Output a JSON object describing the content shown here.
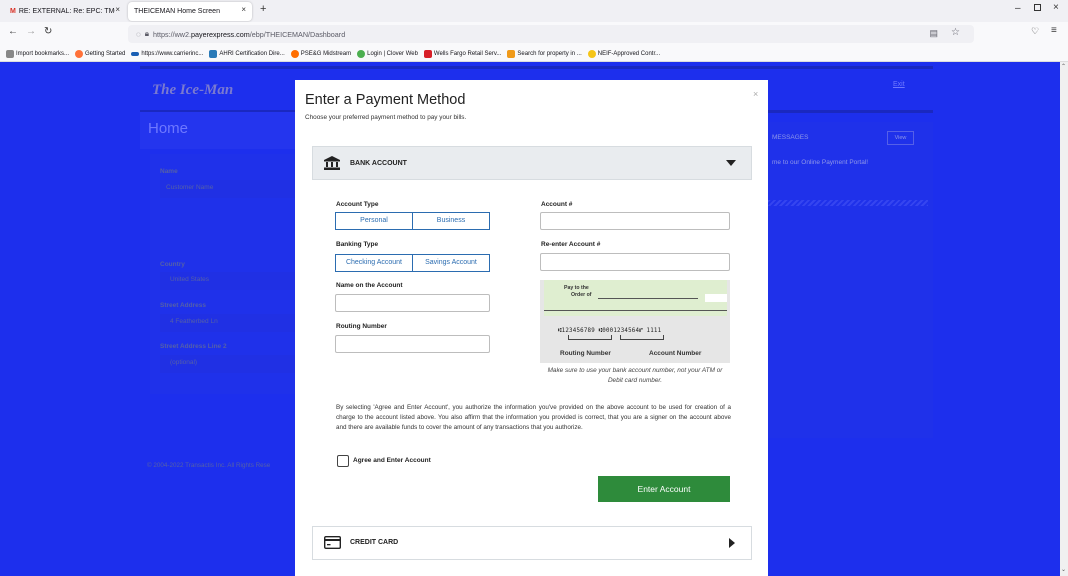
{
  "browser": {
    "tabs": [
      {
        "label": "RE: EXTERNAL: Re: EPC: TMCC",
        "icon": "gmail-icon"
      },
      {
        "label": "THEICEMAN Home Screen",
        "icon": ""
      }
    ],
    "new_tab": "+",
    "url_prefix": "https://ww2.",
    "url_host": "payerexpress.com",
    "url_path": "/ebp/THEICEMAN/Dashboard",
    "bookmarks": [
      {
        "label": "Import bookmarks...",
        "color": "#666666"
      },
      {
        "label": "Getting Started",
        "color": "#ff7139"
      },
      {
        "label": "https://www.carrierinc...",
        "color": "#1a5fb4"
      },
      {
        "label": "AHRI Certification Dire...",
        "color": "#2a7ab8"
      },
      {
        "label": "PSE&G Midstream",
        "color": "#ff6d00"
      },
      {
        "label": "Login | Clover Web",
        "color": "#4caf50"
      },
      {
        "label": "Wells Fargo Retail Serv...",
        "color": "#d71e28"
      },
      {
        "label": "Search for property in ...",
        "color": "#f09a1a"
      },
      {
        "label": "NEIF-Approved Contr...",
        "color": "#f5c518"
      }
    ]
  },
  "background": {
    "logo": "The Ice-Man",
    "exit": "Exit",
    "home_title": "Home",
    "fields": {
      "name_label": "Name",
      "name_value": "Customer Name",
      "country_label": "Country",
      "country_value": "United States",
      "street_label": "Street Address",
      "street_value": "4 Featherbed Ln",
      "street2_label": "Street Address Line 2",
      "street2_value": "(optional)"
    },
    "messages_label": "MESSAGES",
    "view_label": "View",
    "welcome_text": "me to our Online Payment Portal!",
    "footer": "© 2004-2022 Transactis Inc. All Rights Rese"
  },
  "modal": {
    "title": "Enter a Payment Method",
    "subtitle": "Choose your preferred payment method to pay your bills.",
    "close": "×",
    "bank_section": {
      "label": "BANK ACCOUNT",
      "account_type_label": "Account Type",
      "account_types": [
        "Personal",
        "Business"
      ],
      "banking_type_label": "Banking Type",
      "banking_types": [
        "Checking Account",
        "Savings Account"
      ],
      "name_label": "Name on the Account",
      "routing_label": "Routing Number",
      "account_label": "Account #",
      "reenter_label": "Re-enter Account #",
      "check": {
        "pay_to": "Pay to the",
        "order_of": "Order of",
        "micr": "⑆123456789 ⑆0001234564⑈ 1111",
        "routing_caption": "Routing Number",
        "account_caption": "Account Number"
      },
      "note": "Make sure to use your bank account number, not your ATM or Debit card number.",
      "disclaimer": "By selecting 'Agree and Enter Account', you authorize the information you've provided on the above account to be used for creation of a charge to the account listed above. You also affirm that the information you provided is correct, that you are a signer on the account above and there are available funds to cover the amount of any transactions that you authorize.",
      "agree_label": "Agree and Enter Account",
      "submit_label": "Enter Account"
    },
    "credit_section": {
      "label": "CREDIT CARD"
    }
  },
  "colors": {
    "page_bg": "#1d2fed",
    "submit_green": "#2e8b3b",
    "segment_blue": "#2b6cb0"
  }
}
